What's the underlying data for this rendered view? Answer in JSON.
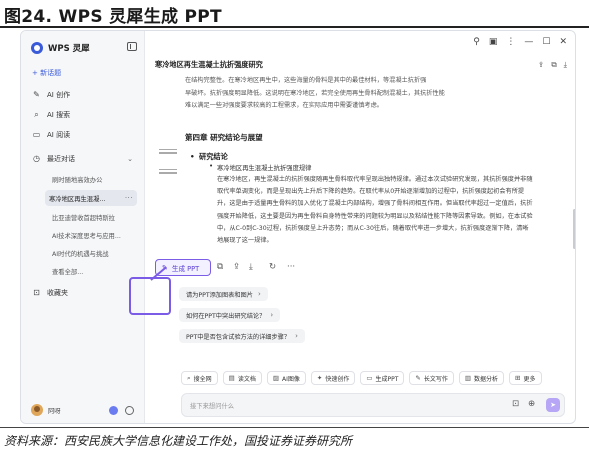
{
  "figure": {
    "title": "图24. WPS 灵犀生成 PPT",
    "source": "资料来源：西安民族大学信息化建设工作处，国投证券证券研究所"
  },
  "app": {
    "name": "WPS 灵犀",
    "sidebar": {
      "new_chat": "+ 新话题",
      "items": [
        {
          "icon": "pen-icon",
          "label": "AI 创作"
        },
        {
          "icon": "search-icon",
          "label": "AI 搜索"
        },
        {
          "icon": "book-icon",
          "label": "AI 阅读"
        },
        {
          "icon": "clock-icon",
          "label": "最近对话"
        }
      ],
      "recent": [
        "刷时随地高效办公",
        "寒冷地区再生混凝...",
        "比亚迪营收首超特斯拉",
        "AI技术深度思考与应用...",
        "AI时代的机遇与挑战",
        "查看全部..."
      ],
      "favorites": "收藏夹",
      "user": "阿呀"
    },
    "document": {
      "title": "寒冷地区再生混凝土抗折强度研究",
      "intro_lines": [
        "在结构完整性。在寒冷地区再生中，这些海量的骨料是其中的最佳材料，等混凝土抗折强",
        "早破坏。抗折强度明显降低。这说明在寒冷地区，若完全使用再生骨料配制混凝土，其抗折性能",
        "难以满足一些对强度要求较高的工程需求，在实际应用中需要谨慎考虑。"
      ],
      "chapter": "第四章 研究结论与展望",
      "section": "研究结论",
      "bullet": "寒冷地区再生混凝土抗折强度规律",
      "body": "在寒冷地区，再生混凝土的抗折强度随再生骨料取代率呈现出独特规律。通过本次试验研究发现，其抗折强度并非随取代率单调变化，而是呈现出先上升后下降的趋势。在取代率从0开始逐渐增加的过程中，抗折强度起初会有所提升，这是由于适量再生骨料的加入优化了混凝土内部结构，增强了骨料间相互作用。但当取代率超过一定值后，抗折强度开始降低，这主要是因为再生骨料自身特性带来的问题较为明显以及粘结性能下降等因素导致。例如，在本试验中，从C-0到C-30过程，抗折强度呈上升态势；而从C-30往后，随着取代率进一步增大，抗折强度逐渐下降，清晰地展现了这一规律。"
    },
    "actions": {
      "generate_ppt": "生成 PPT"
    },
    "suggestions": [
      "请为PPT添加图表和图片",
      "如何在PPT中突出研究结论？",
      "PPT中是否包含试验方法的详细步骤？"
    ],
    "tools": [
      {
        "icon": "search-icon",
        "label": "搜全网"
      },
      {
        "icon": "doc-icon",
        "label": "读文档"
      },
      {
        "icon": "image-icon",
        "label": "AI图像"
      },
      {
        "icon": "create-icon",
        "label": "快速创作"
      },
      {
        "icon": "ppt-icon",
        "label": "生成PPT"
      },
      {
        "icon": "write-icon",
        "label": "长文写作"
      },
      {
        "icon": "chart-icon",
        "label": "数据分析"
      },
      {
        "icon": "more-icon",
        "label": "更多"
      }
    ],
    "input": {
      "placeholder": "接下来想问什么"
    }
  }
}
